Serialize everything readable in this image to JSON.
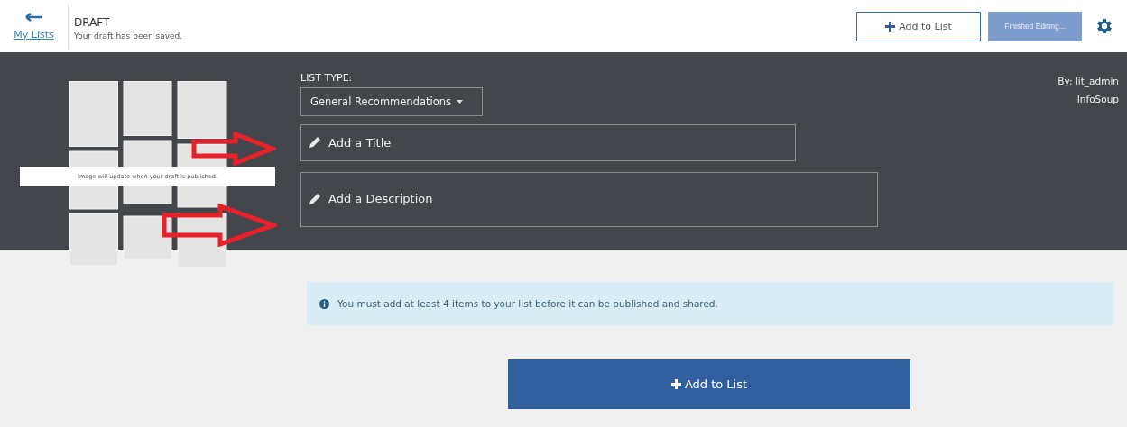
{
  "header": {
    "back_link": "My Lists",
    "title": "DRAFT",
    "subtitle": "Your draft has been saved.",
    "add_button": "Add to List",
    "finish_button": {
      "label": "Finished Editing...",
      "disabled": true
    }
  },
  "hero": {
    "collage_caption": "Image will update when your draft is published.",
    "list_type_label": "LIST TYPE:",
    "list_type_value": "General Recommendations",
    "title_field": {
      "placeholder": "Add a Title"
    },
    "description_field": {
      "placeholder": "Add a Description"
    },
    "author": "By: lit_admin",
    "organization": "InfoSoup"
  },
  "alert": "You must add at least 4 items to your list before it can be published and shared.",
  "add_button": "Add to List"
}
